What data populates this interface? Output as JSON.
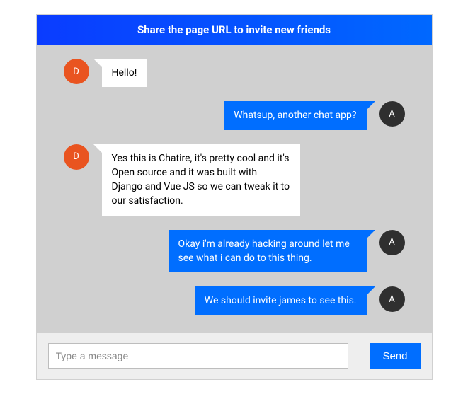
{
  "header": {
    "title": "Share the page URL to invite new friends"
  },
  "users": {
    "left": {
      "initial": "D",
      "color": "orange"
    },
    "right": {
      "initial": "A",
      "color": "dark"
    }
  },
  "messages": [
    {
      "side": "left",
      "text": "Hello!"
    },
    {
      "side": "right",
      "text": "Whatsup, another chat app?"
    },
    {
      "side": "left",
      "text": "Yes this is Chatire, it's pretty cool and it's Open source and it was built with Django and Vue JS so we can tweak it to our satisfaction."
    },
    {
      "side": "right",
      "text": "Okay i'm already hacking around let me see what i can do to this thing."
    },
    {
      "side": "right",
      "text": "We should invite james to see this."
    }
  ],
  "input": {
    "placeholder": "Type a message",
    "value": "",
    "send_label": "Send"
  }
}
